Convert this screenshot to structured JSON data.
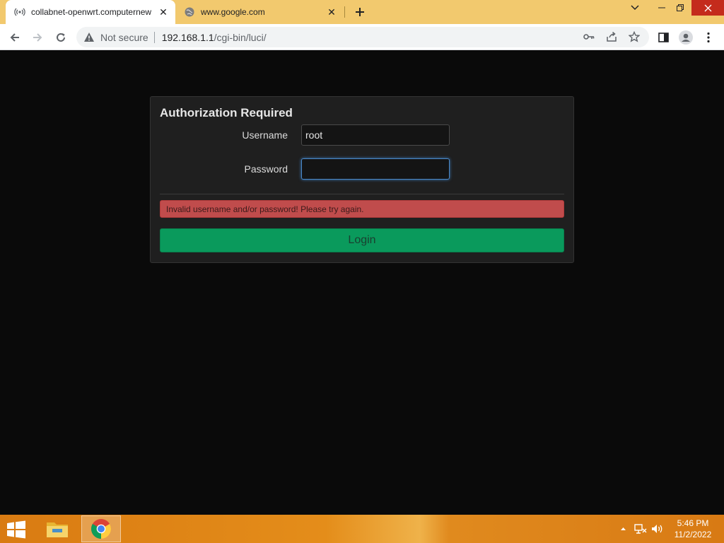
{
  "browser": {
    "tabs": [
      {
        "title": "collabnet-openwrt.computernew",
        "active": true,
        "icon": "radio-signal-icon"
      },
      {
        "title": "www.google.com",
        "active": false,
        "icon": "globe-icon"
      }
    ],
    "new_tab_symbol": "+",
    "omnibox": {
      "security_text": "Not secure",
      "url_host": "192.168.1.1",
      "url_path": "/cgi-bin/luci/"
    },
    "colors": {
      "tabstrip": "#f2c96e",
      "close_button": "#c42b1c"
    }
  },
  "login": {
    "title": "Authorization Required",
    "username_label": "Username",
    "username_value": "root",
    "password_label": "Password",
    "password_value": "",
    "error_message": "Invalid username and/or password! Please try again.",
    "login_button": "Login",
    "colors": {
      "error": "#c04c4c",
      "login_button": "#0a9a5c"
    }
  },
  "taskbar": {
    "apps": [
      {
        "name": "File Explorer",
        "icon": "file-explorer-icon",
        "active": false
      },
      {
        "name": "Google Chrome",
        "icon": "chrome-icon",
        "active": true
      }
    ],
    "clock_time": "5:46 PM",
    "clock_date": "11/2/2022"
  }
}
